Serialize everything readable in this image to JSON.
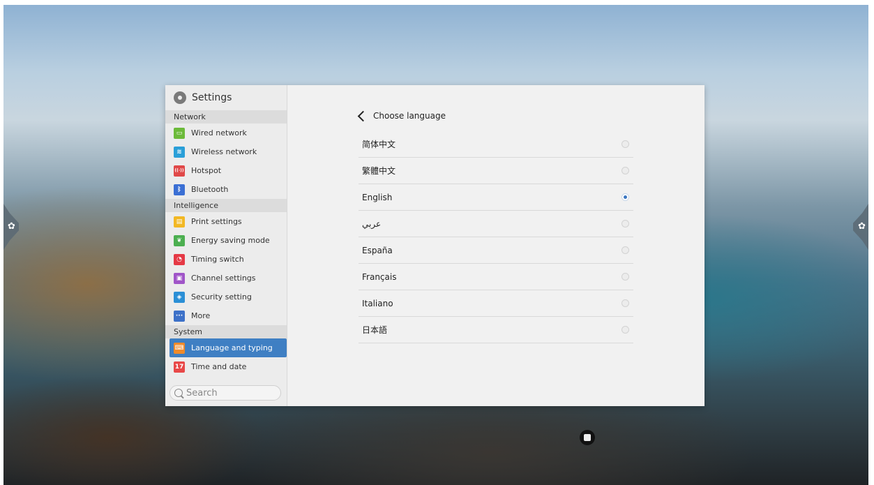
{
  "colors": {
    "accent": "#3f7fc3",
    "radio_selected": "#3a76c0"
  },
  "sidebar": {
    "title": "Settings",
    "sections": [
      {
        "label": "Network",
        "items": [
          {
            "label": "Wired network",
            "icon": "wired-network-icon",
            "color": "#6cba3a"
          },
          {
            "label": "Wireless network",
            "icon": "wifi-icon",
            "color": "#2a9fd8"
          },
          {
            "label": "Hotspot",
            "icon": "hotspot-icon",
            "color": "#e04848"
          },
          {
            "label": "Bluetooth",
            "icon": "bluetooth-icon",
            "color": "#3b6fd4"
          }
        ]
      },
      {
        "label": "Intelligence",
        "items": [
          {
            "label": "Print settings",
            "icon": "printer-icon",
            "color": "#f2b824"
          },
          {
            "label": "Energy saving mode",
            "icon": "leaf-icon",
            "color": "#4caf50"
          },
          {
            "label": "Timing switch",
            "icon": "clock-icon",
            "color": "#e53945"
          },
          {
            "label": "Channel settings",
            "icon": "monitor-icon",
            "color": "#a055c8"
          },
          {
            "label": "Security setting",
            "icon": "shield-icon",
            "color": "#2b8fd6"
          },
          {
            "label": "More",
            "icon": "more-icon",
            "color": "#3d71c8"
          }
        ]
      },
      {
        "label": "System",
        "items": [
          {
            "label": "Language and typing",
            "icon": "keyboard-icon",
            "color": "#f08a2a",
            "active": true
          },
          {
            "label": "Time and date",
            "icon": "calendar-icon",
            "color": "#e84848"
          }
        ]
      }
    ],
    "search_placeholder": "Search"
  },
  "content": {
    "back_label": "Choose language",
    "languages": [
      {
        "label": "简体中文",
        "selected": false
      },
      {
        "label": "繁體中文",
        "selected": false
      },
      {
        "label": "English",
        "selected": true
      },
      {
        "label": "عربي",
        "selected": false
      },
      {
        "label": "España",
        "selected": false
      },
      {
        "label": "Français",
        "selected": false
      },
      {
        "label": "Italiano",
        "selected": false
      },
      {
        "label": "日本語",
        "selected": false
      }
    ]
  }
}
